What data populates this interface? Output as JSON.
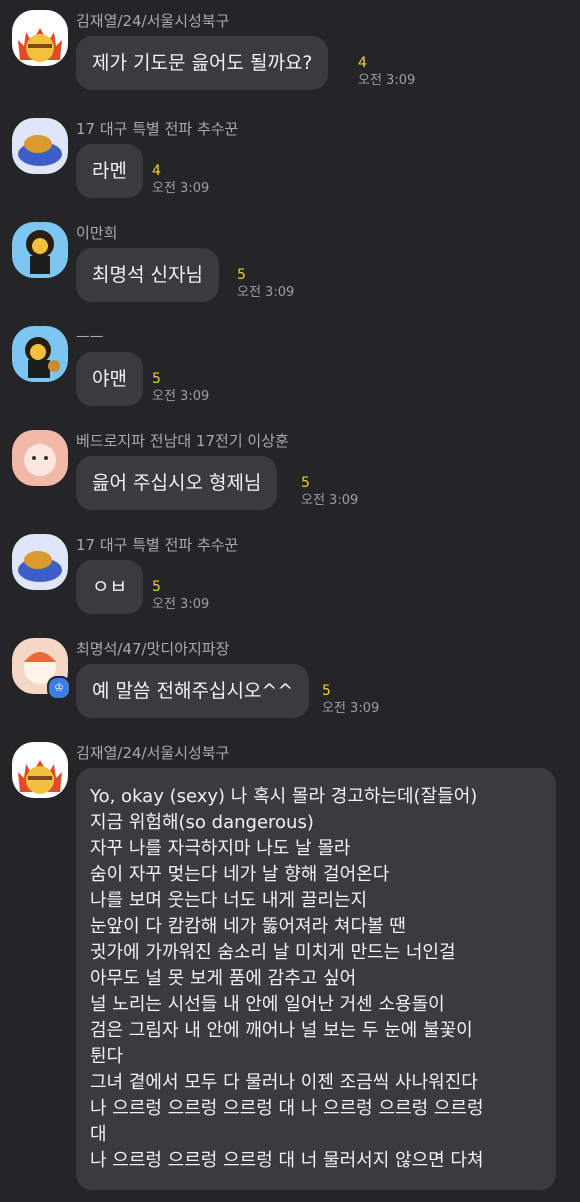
{
  "messages": [
    {
      "sender": "김재열/24/서울시성북구",
      "text": "제가 기도문 읊어도 될까요?",
      "count": "4",
      "time": "오전 3:09"
    },
    {
      "sender": "17 대구 특별 전파 추수꾼",
      "text": "라멘",
      "count": "4",
      "time": "오전 3:09"
    },
    {
      "sender": "이만희",
      "text": "최명석 신자님",
      "count": "5",
      "time": "오전 3:09"
    },
    {
      "sender": "ㅡㅡ",
      "text": "야맨",
      "count": "5",
      "time": "오전 3:09"
    },
    {
      "sender": "베드로지파 전남대 17전기 이상훈",
      "text": "읊어 주십시오 형제님",
      "count": "5",
      "time": "오전 3:09"
    },
    {
      "sender": "17 대구 특별 전파 추수꾼",
      "text": "ㅇㅂ",
      "count": "5",
      "time": "오전 3:09"
    },
    {
      "sender": "최명석/47/맛디아지파장",
      "text": "예 말씀 전해주십시오^^",
      "count": "5",
      "time": "오전 3:09"
    }
  ],
  "long_message": {
    "sender": "김재열/24/서울시성북구",
    "lines": [
      "Yo, okay (sexy) 나 혹시 몰라 경고하는데(잘들어)",
      "지금 위험해(so dangerous)",
      "자꾸 나를 자극하지마 나도 날 몰라",
      "숨이 자꾸 멎는다 네가 날 향해 걸어온다",
      "나를 보며 웃는다 너도 내게 끌리는지",
      "눈앞이 다 캄캄해 네가 뚫어져라 쳐다볼 땐",
      "귓가에 가까워진 숨소리 날 미치게 만드는 너인걸",
      "아무도 널 못 보게 품에 감추고 싶어",
      "널 노리는 시선들 내 안에 일어난 거센 소용돌이",
      "검은 그림자 내 안에 깨어나 널 보는 두 눈에 불꽃이",
      "튄다",
      "그녀 곁에서 모두 다 물러나 이젠 조금씩 사나워진다",
      "나 으르렁 으르렁 으르렁 대 나 으르렁 으르렁 으르렁",
      "대",
      "나 으르렁 으르렁 으르렁 대 너 물러서지 않으면 다쳐"
    ]
  },
  "icons": {
    "owner_badge": "crown-icon"
  },
  "colors": {
    "background": "#252528",
    "bubble": "#3b3b3f",
    "unread": "#f5d225"
  }
}
